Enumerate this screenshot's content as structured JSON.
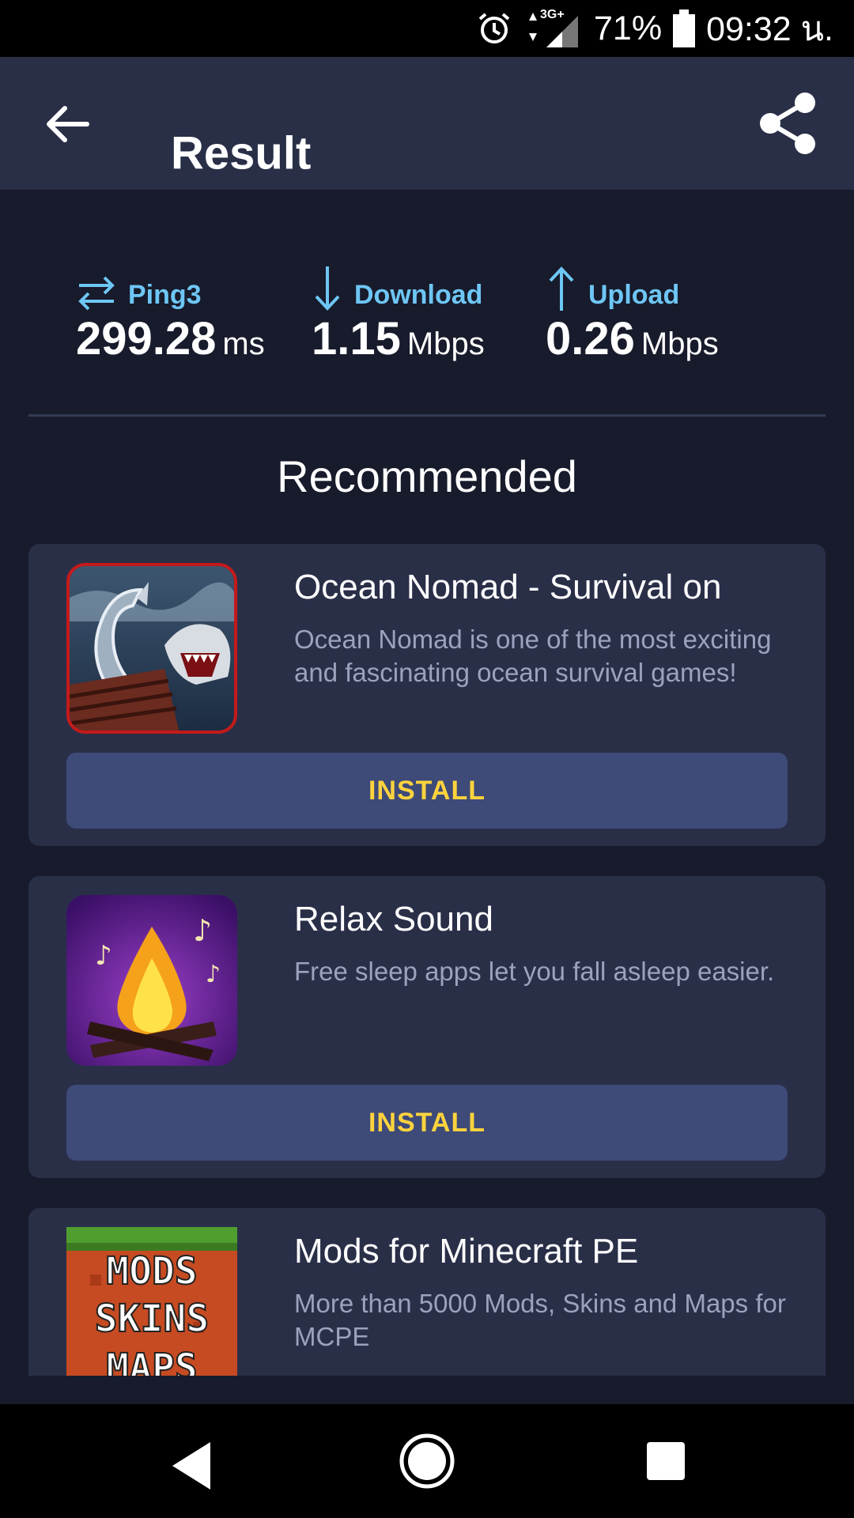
{
  "status_bar": {
    "network": "3G+",
    "battery": "71%",
    "time": "09:32 น."
  },
  "app_bar": {
    "title": "Result"
  },
  "metrics": {
    "ping": {
      "label": "Ping3",
      "value": "299.28",
      "unit": "ms"
    },
    "download": {
      "label": "Download",
      "value": "1.15",
      "unit": "Mbps"
    },
    "upload": {
      "label": "Upload",
      "value": "0.26",
      "unit": "Mbps"
    }
  },
  "recommended": {
    "title": "Recommended",
    "install_label": "INSTALL",
    "apps": [
      {
        "name": "Ocean Nomad - Survival on",
        "description": "Ocean Nomad is one of the most exciting and fascinating ocean survival games!"
      },
      {
        "name": "Relax Sound",
        "description": "Free sleep apps let you fall asleep easier."
      },
      {
        "name": "Mods for Minecraft PE",
        "description": "More than 5000 Mods, Skins and Maps for MCPE",
        "icon_text": [
          "MODS",
          "SKINS",
          "MAPS"
        ]
      }
    ]
  },
  "colors": {
    "background": "#171b2b",
    "surface": "#2a2f48",
    "accent_blue": "#6ec6f5",
    "install_button": "#3e4a78",
    "install_text": "#ffd33d"
  }
}
